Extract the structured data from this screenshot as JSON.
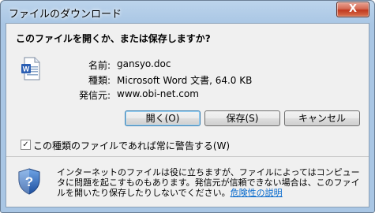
{
  "window": {
    "title": "ファイルのダウンロード",
    "close_label": "X"
  },
  "dialog": {
    "question": "このファイルを開くか、または保存しますか?",
    "fields": [
      {
        "label": "名前:",
        "value": "gansyo.doc"
      },
      {
        "label": "種類:",
        "value": "Microsoft Word 文書, 64.0 KB"
      },
      {
        "label": "発信元:",
        "value": "www.obi-net.com"
      }
    ],
    "buttons": {
      "open": "開く(O)",
      "save": "保存(S)",
      "cancel": "キャンセル"
    },
    "checkbox": {
      "label": "この種類のファイルであれば常に警告する(W)",
      "checked": true,
      "mark": "✓"
    },
    "warning": {
      "text": "インターネットのファイルは役に立ちますが、ファイルによってはコンピュータに問題を起こすものもあります。発信元が信頼できない場合は、このファイルを開いたり保存したりしないでください。",
      "link": "危険性の説明"
    },
    "icons": {
      "file": "word-document-icon",
      "security": "security-shield-icon"
    }
  }
}
